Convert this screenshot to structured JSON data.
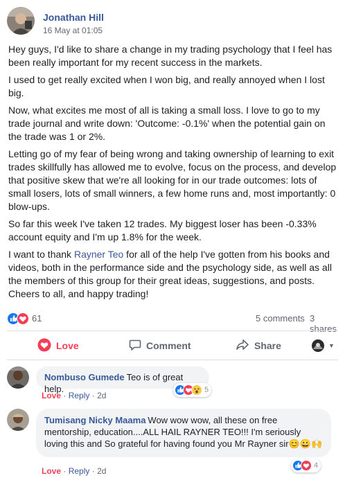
{
  "post": {
    "author": "Jonathan Hill",
    "timestamp": "16 May at 01:05",
    "paragraphs": [
      "Hey guys, I'd like to share a change in my trading psychology that I feel has been really important for my recent success in the markets.",
      "I used to get really excited when I won big, and really annoyed when I lost big.",
      "Now, what excites me most of all is taking a small loss. I love to go to my trade journal and write down: 'Outcome: -0.1%' when the potential gain on the trade was 1 or 2%.",
      "Letting go of my fear of being wrong and taking ownership of learning to exit trades skillfully has allowed me to evolve, focus on the process, and develop that positive skew that we're all looking for in our trade outcomes: lots of small losers, lots of small winners, a few home runs and, most importantly: 0 blow-ups.",
      "So far this week I've taken 12 trades. My biggest loser has been -0.33% account equity and I'm up 1.8% for the week."
    ],
    "last_paragraph": {
      "before": "I want to thank ",
      "mention": "Rayner Teo",
      "after": " for all of the help I've gotten from his books and videos, both in the performance side and the psychology side, as well as all the members of this group for their great ideas, suggestions, and posts. Cheers to all, and happy trading!"
    }
  },
  "stats": {
    "reactions": "61",
    "comments": "5 comments",
    "shares": "3 shares"
  },
  "actions": {
    "love": "Love",
    "comment": "Comment",
    "share": "Share"
  },
  "comments": [
    {
      "name": "Nombuso Gumede",
      "text": "Teo is of great help.",
      "like": "Love",
      "reply": "Reply",
      "time": "2d",
      "reactions": "5"
    },
    {
      "name": "Tumisang Nicky Maama",
      "text": "Wow wow wow, all these on free mentorship, education....ALL HAIL RAYNER TEO!!! I'm seriously loving this and So grateful for having found you Mr Rayner sir",
      "emojis": "😊😀🙌",
      "like": "Love",
      "reply": "Reply",
      "time": "2d",
      "reactions": "4"
    }
  ],
  "colors": {
    "link": "#385898",
    "love": "#f33e58",
    "like": "#1877f2",
    "muted": "#606770",
    "bubble": "#f2f3f5"
  }
}
